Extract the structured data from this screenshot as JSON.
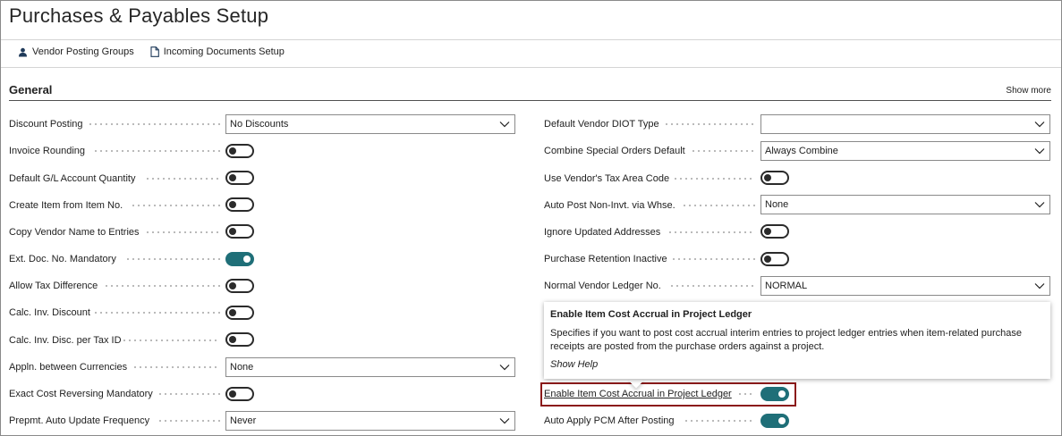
{
  "page": {
    "title": "Purchases & Payables Setup"
  },
  "actions": [
    {
      "label": "Vendor Posting Groups",
      "icon": "person-icon"
    },
    {
      "label": "Incoming Documents Setup",
      "icon": "document-icon"
    }
  ],
  "section": {
    "title": "General",
    "show_more": "Show more"
  },
  "left_fields": [
    {
      "label": "Discount Posting",
      "type": "select",
      "value": "No Discounts"
    },
    {
      "label": "Invoice Rounding",
      "type": "toggle",
      "on": false
    },
    {
      "label": "Default G/L Account Quantity",
      "type": "toggle",
      "on": false
    },
    {
      "label": "Create Item from Item No.",
      "type": "toggle",
      "on": false
    },
    {
      "label": "Copy Vendor Name to Entries",
      "type": "toggle",
      "on": false
    },
    {
      "label": "Ext. Doc. No. Mandatory",
      "type": "toggle",
      "on": true
    },
    {
      "label": "Allow Tax Difference",
      "type": "toggle",
      "on": false
    },
    {
      "label": "Calc. Inv. Discount",
      "type": "toggle",
      "on": false
    },
    {
      "label": "Calc. Inv. Disc. per Tax ID",
      "type": "toggle",
      "on": false
    },
    {
      "label": "Appln. between Currencies",
      "type": "select",
      "value": "None"
    },
    {
      "label": "Exact Cost Reversing Mandatory",
      "type": "toggle",
      "on": false
    },
    {
      "label": "Prepmt. Auto Update Frequency",
      "type": "select",
      "value": "Never"
    }
  ],
  "right_fields": [
    {
      "label": "Default Vendor DIOT Type",
      "type": "select",
      "value": ""
    },
    {
      "label": "Combine Special Orders Default",
      "type": "select",
      "value": "Always Combine"
    },
    {
      "label": "Use Vendor's Tax Area Code",
      "type": "toggle",
      "on": false
    },
    {
      "label": "Auto Post Non-Invt. via Whse.",
      "type": "select",
      "value": "None"
    },
    {
      "label": "Ignore Updated Addresses",
      "type": "toggle",
      "on": false
    },
    {
      "label": "Purchase Retention Inactive",
      "type": "toggle",
      "on": false
    },
    {
      "label": "Normal Vendor Ledger No.",
      "type": "select",
      "value": "NORMAL"
    }
  ],
  "highlighted_field": {
    "label": "Enable Item Cost Accrual in Project Ledger",
    "on": true
  },
  "last_field": {
    "label": "Auto Apply PCM After Posting",
    "on": true
  },
  "tooltip": {
    "title": "Enable Item Cost Accrual in Project Ledger",
    "body": "Specifies if you want to post cost accrual interim entries to project ledger entries when item-related purchase receipts are posted from the purchase orders against a project.",
    "help": "Show Help"
  },
  "colors": {
    "accent": "#1f6f78",
    "highlight_border": "#8b1a1a"
  }
}
